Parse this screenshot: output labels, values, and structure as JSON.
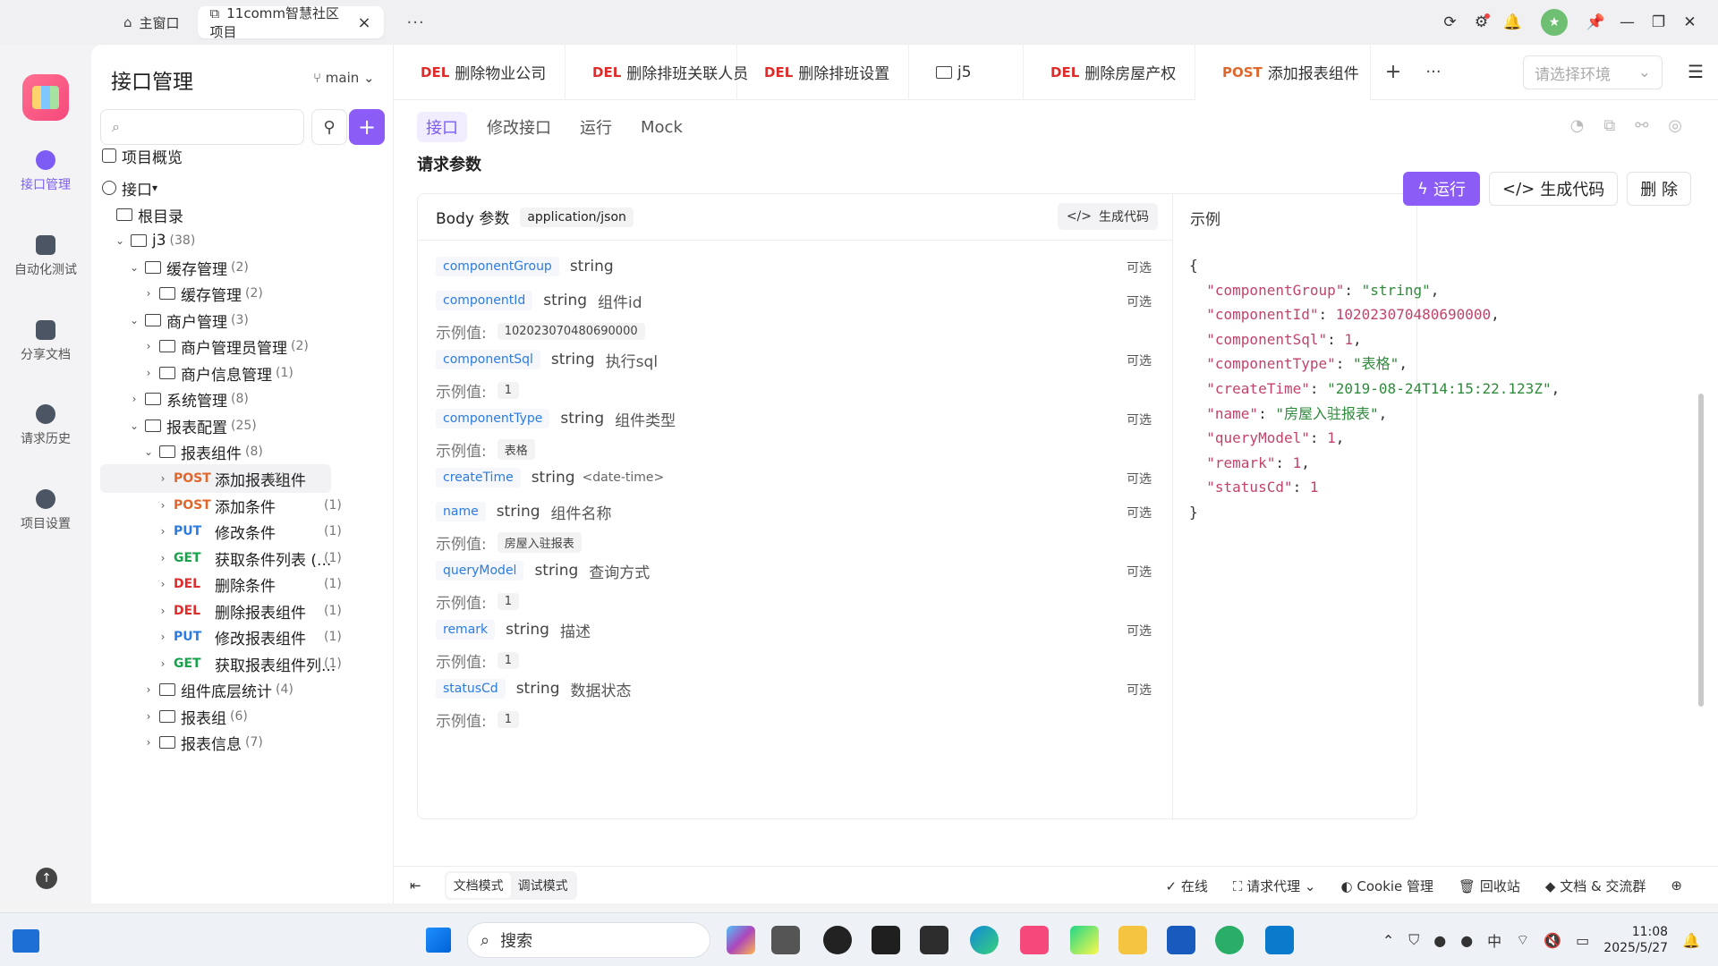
{
  "titlebar": {
    "home_tab": "主窗口",
    "project_tab": "11comm智慧社区项目",
    "close": "×",
    "more": "···"
  },
  "leftnav": {
    "items": [
      {
        "label": "接口管理"
      },
      {
        "label": "自动化测试"
      },
      {
        "label": "分享文档"
      },
      {
        "label": "请求历史"
      },
      {
        "label": "项目设置"
      }
    ]
  },
  "tree": {
    "title": "接口管理",
    "branch": "main",
    "search_placeholder": "",
    "rows": [
      {
        "label": "项目概览"
      },
      {
        "label": "接口"
      },
      {
        "label": "根目录"
      },
      {
        "label": "j3",
        "count": "(38)"
      },
      {
        "label": "缓存管理",
        "count": "(2)"
      },
      {
        "label": "缓存管理",
        "count": "(2)"
      },
      {
        "label": "商户管理",
        "count": "(3)"
      },
      {
        "label": "商户管理员管理",
        "count": "(2)"
      },
      {
        "label": "商户信息管理",
        "count": "(1)"
      },
      {
        "label": "系统管理",
        "count": "(8)"
      },
      {
        "label": "报表配置",
        "count": "(25)"
      },
      {
        "label": "报表组件",
        "count": "(8)"
      },
      {
        "method": "POST",
        "label": "添加报表组件",
        "count": "(1)"
      },
      {
        "method": "POST",
        "label": "添加条件",
        "count": "(1)"
      },
      {
        "method": "PUT",
        "label": "修改条件",
        "count": "(1)"
      },
      {
        "method": "GET",
        "label": "获取条件列表 (...",
        "count": "(1)"
      },
      {
        "method": "DEL",
        "label": "删除条件",
        "count": "(1)"
      },
      {
        "method": "DEL",
        "label": "删除报表组件",
        "count": "(1)"
      },
      {
        "method": "PUT",
        "label": "修改报表组件",
        "count": "(1)"
      },
      {
        "method": "GET",
        "label": "获取报表组件列...",
        "count": "(1)"
      },
      {
        "label": "组件底层统计",
        "count": "(4)"
      },
      {
        "label": "报表组",
        "count": "(6)"
      },
      {
        "label": "报表信息",
        "count": "(7)"
      }
    ]
  },
  "reqtabs": [
    {
      "method": "DEL",
      "label": "删除物业公司"
    },
    {
      "method": "DEL",
      "label": "删除排班关联人员"
    },
    {
      "method": "DEL",
      "label": "删除排班设置"
    },
    {
      "method": "",
      "label": "j5"
    },
    {
      "method": "DEL",
      "label": "删除房屋产权"
    },
    {
      "method": "POST",
      "label": "添加报表组件"
    }
  ],
  "env_placeholder": "请选择环境",
  "subtabs": [
    "接口",
    "修改接口",
    "运行",
    "Mock"
  ],
  "section_title": "请求参数",
  "actions": {
    "run": "运行",
    "gencode": "生成代码",
    "delete": "删 除"
  },
  "body": {
    "title": "Body 参数",
    "content_type": "application/json",
    "gencode": "生成代码",
    "example_title": "示例",
    "example_label": "示例值:",
    "optional": "可选",
    "params": [
      {
        "name": "componentGroup",
        "type": "string",
        "desc": "",
        "fmt": "",
        "example": ""
      },
      {
        "name": "componentId",
        "type": "string",
        "desc": "组件id",
        "fmt": "",
        "example": "102023070480690000"
      },
      {
        "name": "componentSql",
        "type": "string",
        "desc": "执行sql",
        "fmt": "",
        "example": "1"
      },
      {
        "name": "componentType",
        "type": "string",
        "desc": "组件类型",
        "fmt": "",
        "example": "表格"
      },
      {
        "name": "createTime",
        "type": "string",
        "desc": "",
        "fmt": "<date-time>",
        "example": ""
      },
      {
        "name": "name",
        "type": "string",
        "desc": "组件名称",
        "fmt": "",
        "example": "房屋入驻报表"
      },
      {
        "name": "queryModel",
        "type": "string",
        "desc": "查询方式",
        "fmt": "",
        "example": "1"
      },
      {
        "name": "remark",
        "type": "string",
        "desc": "描述",
        "fmt": "",
        "example": "1"
      },
      {
        "name": "statusCd",
        "type": "string",
        "desc": "数据状态",
        "fmt": "",
        "example": "1"
      }
    ]
  },
  "example_json": [
    {
      "key": "\"componentGroup\"",
      "val": "\"string\"",
      "kind": "s",
      "comma": ","
    },
    {
      "key": "\"componentId\"",
      "val": "102023070480690000",
      "kind": "n",
      "comma": ","
    },
    {
      "key": "\"componentSql\"",
      "val": "1",
      "kind": "n",
      "comma": ","
    },
    {
      "key": "\"componentType\"",
      "val": "\"表格\"",
      "kind": "s",
      "comma": ","
    },
    {
      "key": "\"createTime\"",
      "val": "\"2019-08-24T14:15:22.123Z\"",
      "kind": "s",
      "comma": ","
    },
    {
      "key": "\"name\"",
      "val": "\"房屋入驻报表\"",
      "kind": "s",
      "comma": ","
    },
    {
      "key": "\"queryModel\"",
      "val": "1",
      "kind": "n",
      "comma": ","
    },
    {
      "key": "\"remark\"",
      "val": "1",
      "kind": "n",
      "comma": ","
    },
    {
      "key": "\"statusCd\"",
      "val": "1",
      "kind": "n",
      "comma": ""
    }
  ],
  "bottombar": {
    "mode_doc": "文档模式",
    "mode_debug": "调试模式",
    "online": "在线",
    "proxy": "请求代理",
    "cookie": "Cookie 管理",
    "trash": "回收站",
    "docs": "文档 & 交流群"
  },
  "taskbar": {
    "search": "搜索",
    "ime": "中",
    "time": "11:08",
    "date": "2025/5/27"
  },
  "colors": {
    "accent": "#8b5cf6",
    "post": "#e0672b",
    "put": "#2b7be0",
    "get": "#16a34a",
    "del": "#e02b2b"
  }
}
